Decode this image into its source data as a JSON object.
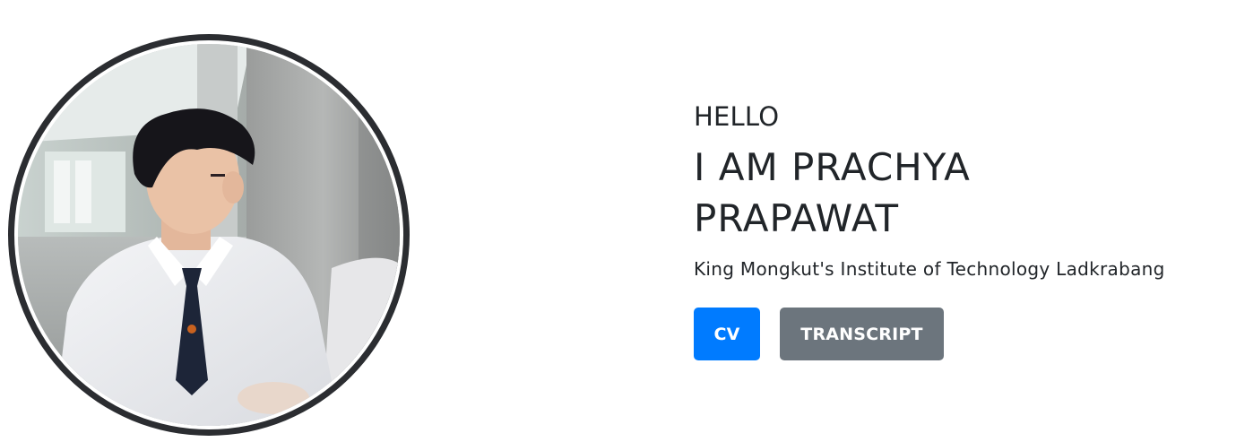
{
  "hero": {
    "greeting": "HELLO",
    "name": "I AM PRACHYA PRAPAWAT",
    "institute": "King Mongkut's Institute of Technology Ladkrabang",
    "photo_alt": "Profile photo",
    "buttons": {
      "cv_label": "CV",
      "transcript_label": "TRANSCRIPT"
    }
  },
  "colors": {
    "primary": "#007bff",
    "secondary": "#6c757d",
    "ring": "#2b2d31",
    "text": "#212529"
  }
}
